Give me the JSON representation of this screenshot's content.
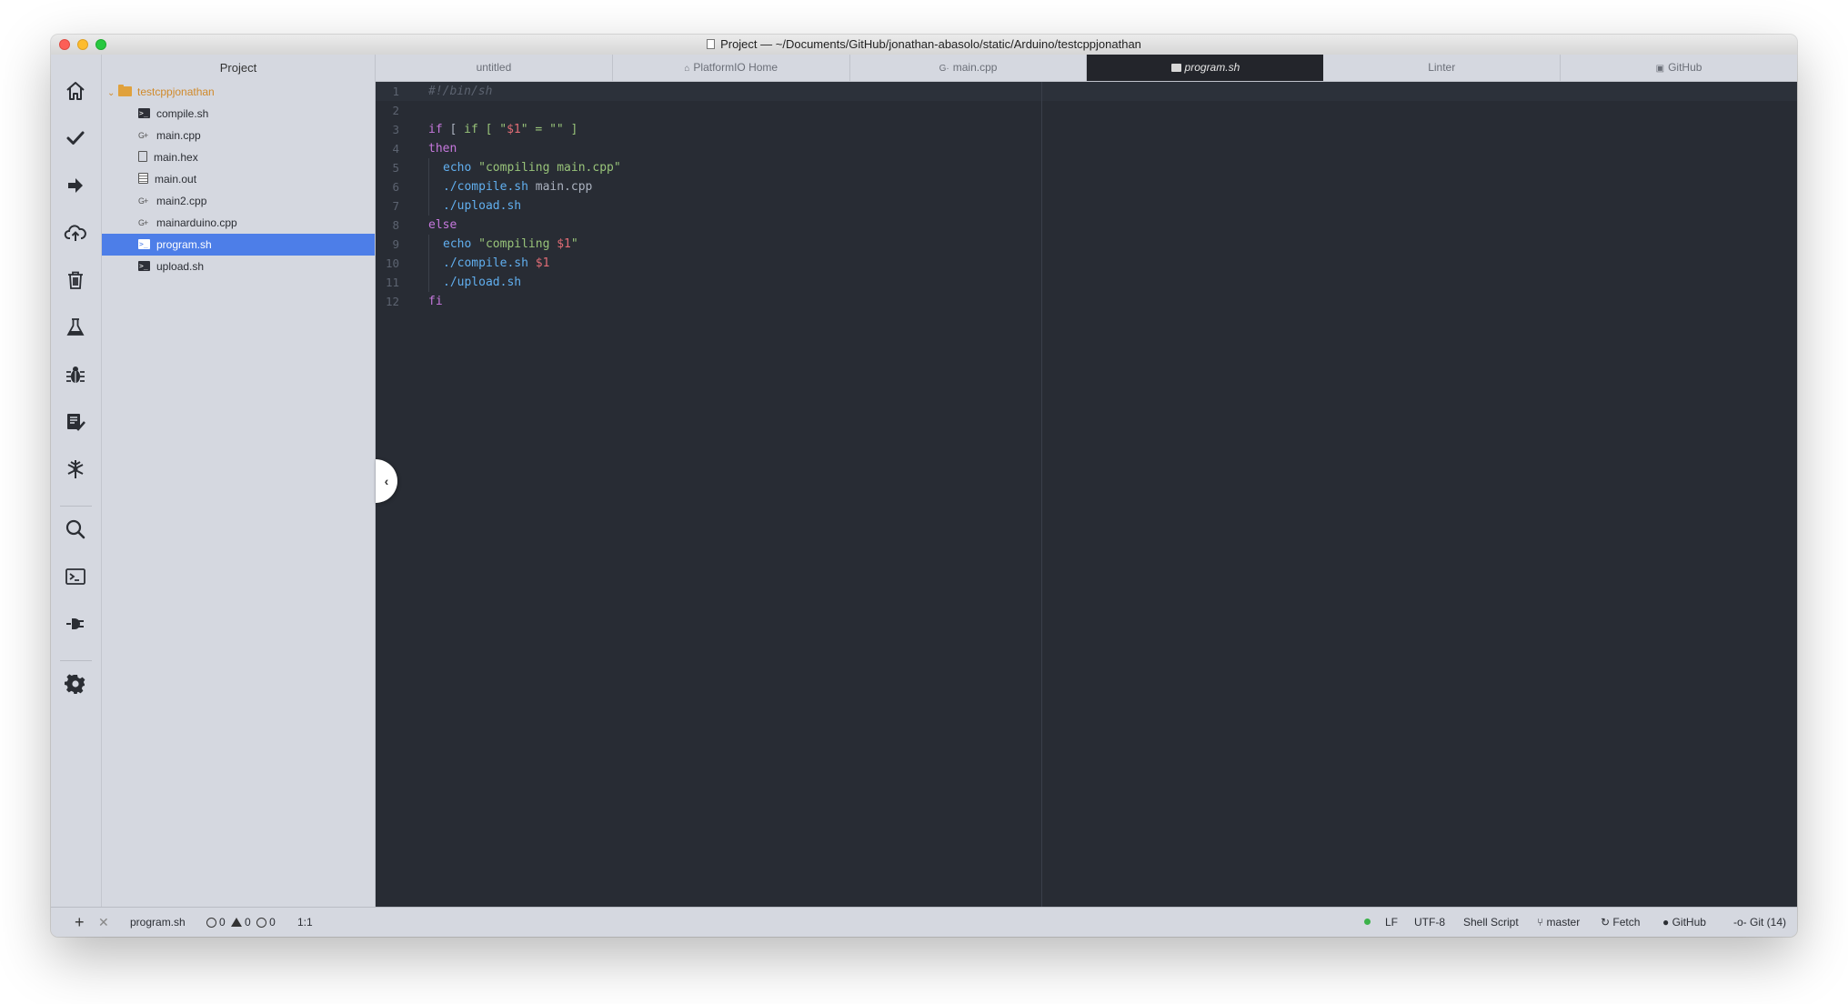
{
  "window": {
    "title": "Project — ~/Documents/GitHub/jonathan-abasolo/static/Arduino/testcppjonathan"
  },
  "activity_bar": {
    "icons": [
      "home-icon",
      "check-icon",
      "arrow-right-icon",
      "cloud-upload-icon",
      "trash-icon",
      "flask-icon",
      "bug-icon",
      "task-list-icon",
      "unit-test-icon",
      "search-icon",
      "terminal-icon",
      "plug-icon",
      "gear-icon"
    ]
  },
  "tree": {
    "title": "Project",
    "root": "testcppjonathan",
    "items": [
      {
        "label": "compile.sh",
        "icon": "terminal-file-icon"
      },
      {
        "label": "main.cpp",
        "icon": "cpp-file-icon"
      },
      {
        "label": "main.hex",
        "icon": "file-icon"
      },
      {
        "label": "main.out",
        "icon": "binary-file-icon"
      },
      {
        "label": "main2.cpp",
        "icon": "cpp-file-icon"
      },
      {
        "label": "mainarduino.cpp",
        "icon": "cpp-file-icon"
      },
      {
        "label": "program.sh",
        "icon": "terminal-file-icon",
        "selected": true
      },
      {
        "label": "upload.sh",
        "icon": "terminal-file-icon"
      }
    ]
  },
  "tabs": [
    {
      "label": "untitled"
    },
    {
      "label": "PlatformIO Home",
      "icon": "home-icon"
    },
    {
      "label": "main.cpp",
      "icon": "cpp-file-icon"
    },
    {
      "label": "program.sh",
      "icon": "terminal-file-icon",
      "active": true
    },
    {
      "label": "Linter"
    },
    {
      "label": "GitHub",
      "icon": "github-icon"
    }
  ],
  "editor": {
    "line_numbers": [
      "1",
      "2",
      "3",
      "4",
      "5",
      "6",
      "7",
      "8",
      "9",
      "10",
      "11",
      "12"
    ],
    "lines": {
      "l1": "#!/bin/sh",
      "l3_a": "if [ \"",
      "l3_b": "$1",
      "l3_c": "\" = \"\" ]",
      "l4": "then",
      "l5_a": "echo ",
      "l5_b": "\"compiling main.cpp\"",
      "l6_a": "./compile.sh",
      "l6_b": " main.cpp",
      "l7": "./upload.sh",
      "l8": "else",
      "l9_a": "echo ",
      "l9_b": "\"compiling ",
      "l9_c": "$1",
      "l9_d": "\"",
      "l10_a": "./compile.sh ",
      "l10_b": "$1",
      "l11": "./upload.sh",
      "l12": "fi"
    }
  },
  "status": {
    "file": "program.sh",
    "errors": "0",
    "warnings": "0",
    "infos": "0",
    "cursor": "1:1",
    "line_ending": "LF",
    "encoding": "UTF-8",
    "grammar": "Shell Script",
    "branch": "master",
    "fetch": "Fetch",
    "github": "GitHub",
    "git": "Git (14)"
  },
  "colors": {
    "accent": "#4d7ee8",
    "editor_bg": "#282c34",
    "folder": "#d08a2b"
  }
}
